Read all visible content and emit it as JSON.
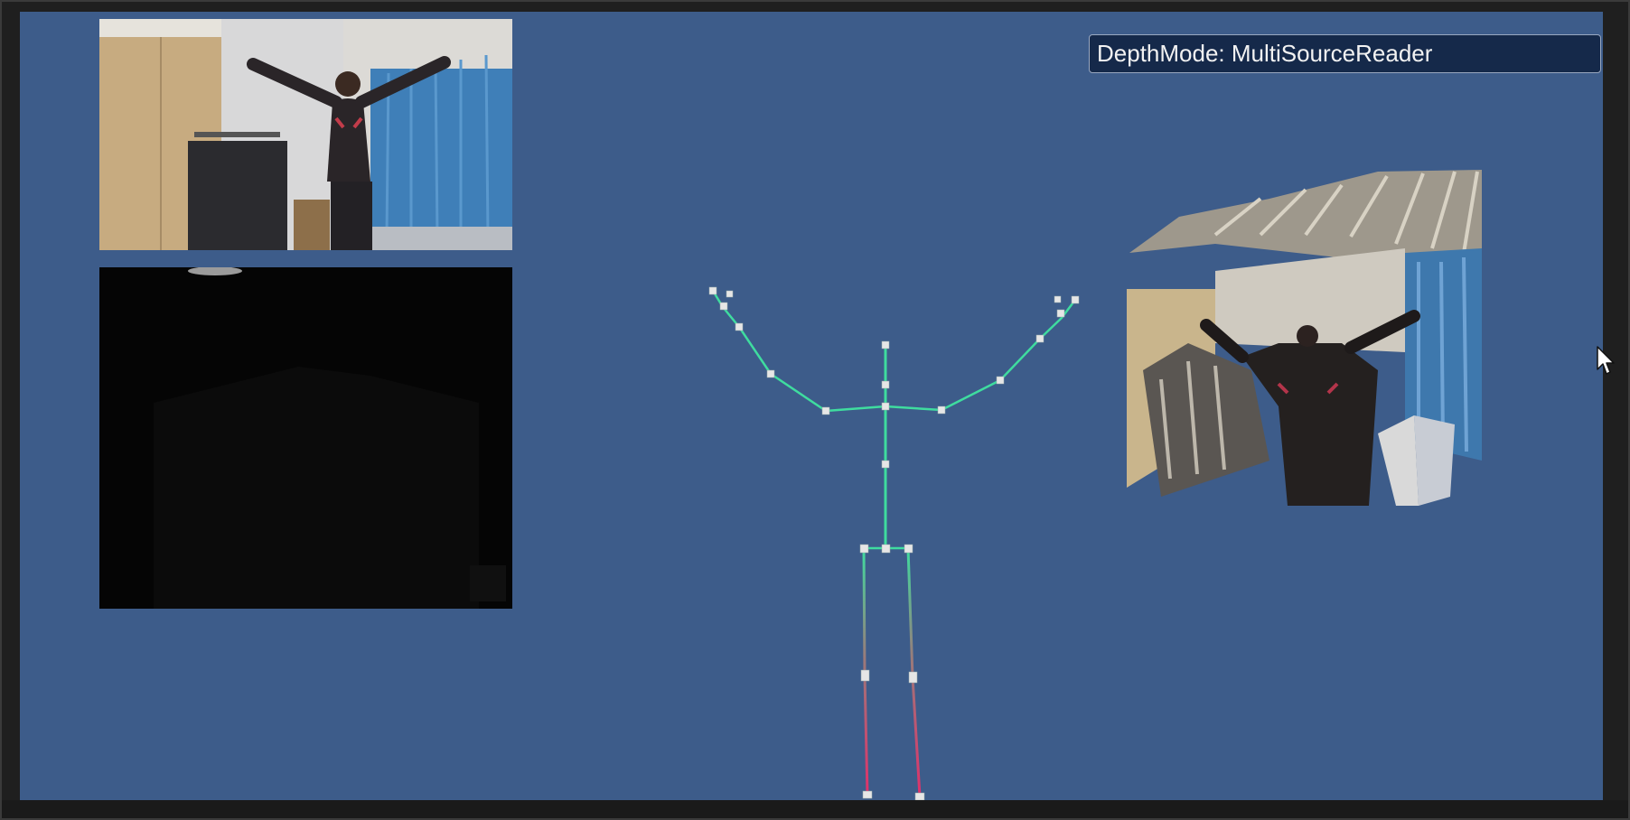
{
  "depth_mode_label": "DepthMode: MultiSourceReader",
  "colors": {
    "viewport_background": "#3d5c8a",
    "label_background": "#15294a",
    "skeleton_upper": "#3fdc9f",
    "skeleton_lower": "#e0306a",
    "joint": "#e6e6e6"
  },
  "icons": [
    "mouse-cursor-icon"
  ]
}
